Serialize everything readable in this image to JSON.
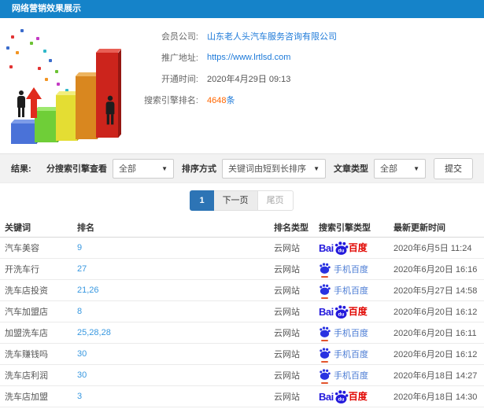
{
  "header": {
    "title": "网络营销效果展示"
  },
  "profile": {
    "company_label": "会员公司:",
    "company_value": "山东老人头汽车服务咨询有限公司",
    "url_label": "推广地址:",
    "url_value": "https://www.lrtlsd.com",
    "opened_label": "开通时间:",
    "opened_value": "2020年4月29日 09:13",
    "ranking_label": "搜索引擎排名:",
    "ranking_value": "4648",
    "ranking_suffix": "条"
  },
  "filters": {
    "section_label": "结果:",
    "engine_label": "分搜索引擎查看",
    "engine_value": "全部",
    "sort_label": "排序方式",
    "sort_value": "关键词由短到长排序",
    "type_label": "文章类型",
    "type_value": "全部",
    "submit_label": "提交",
    "caret": "▼"
  },
  "pagination": {
    "current": "1",
    "next": "下一页",
    "last": "尾页"
  },
  "table": {
    "headers": [
      "关键词",
      "排名",
      "排名类型",
      "搜索引擎类型",
      "最新更新时间"
    ],
    "rows": [
      {
        "keyword": "汽车美容",
        "rank": "9",
        "rank_type": "云网站",
        "engine": "baidu",
        "updated": "2020年6月5日 11:24"
      },
      {
        "keyword": "开洗车行",
        "rank": "27",
        "rank_type": "云网站",
        "engine": "baidu_mobile",
        "updated": "2020年6月20日 16:16"
      },
      {
        "keyword": "洗车店投资",
        "rank": "21,26",
        "rank_type": "云网站",
        "engine": "baidu_mobile",
        "updated": "2020年5月27日 14:58"
      },
      {
        "keyword": "汽车加盟店",
        "rank": "8",
        "rank_type": "云网站",
        "engine": "baidu",
        "updated": "2020年6月20日 16:12"
      },
      {
        "keyword": "加盟洗车店",
        "rank": "25,28,28",
        "rank_type": "云网站",
        "engine": "baidu_mobile",
        "updated": "2020年6月20日 16:11"
      },
      {
        "keyword": "洗车赚钱吗",
        "rank": "30",
        "rank_type": "云网站",
        "engine": "baidu_mobile",
        "updated": "2020年6月20日 16:12"
      },
      {
        "keyword": "洗车店利润",
        "rank": "30",
        "rank_type": "云网站",
        "engine": "baidu_mobile",
        "updated": "2020年6月18日 14:27"
      },
      {
        "keyword": "洗车店加盟",
        "rank": "3",
        "rank_type": "云网站",
        "engine": "baidu",
        "updated": "2020年6月18日 14:30"
      }
    ]
  },
  "engine_logos": {
    "baidu": {
      "prefix": "Bai",
      "paw_text": "du",
      "suffix": "百度"
    },
    "baidu_mobile": {
      "label": "手机百度"
    }
  },
  "colors": {
    "header_blue": "#1583c9",
    "link_blue": "#1d7ad9",
    "rank_link_blue": "#3898e0",
    "ranking_orange": "#ff6600",
    "pagination_active_blue": "#2d74b5",
    "baidu_blue": "#2319dc",
    "baidu_red": "#e10601",
    "filter_bar_gray": "#f2f2f2"
  }
}
